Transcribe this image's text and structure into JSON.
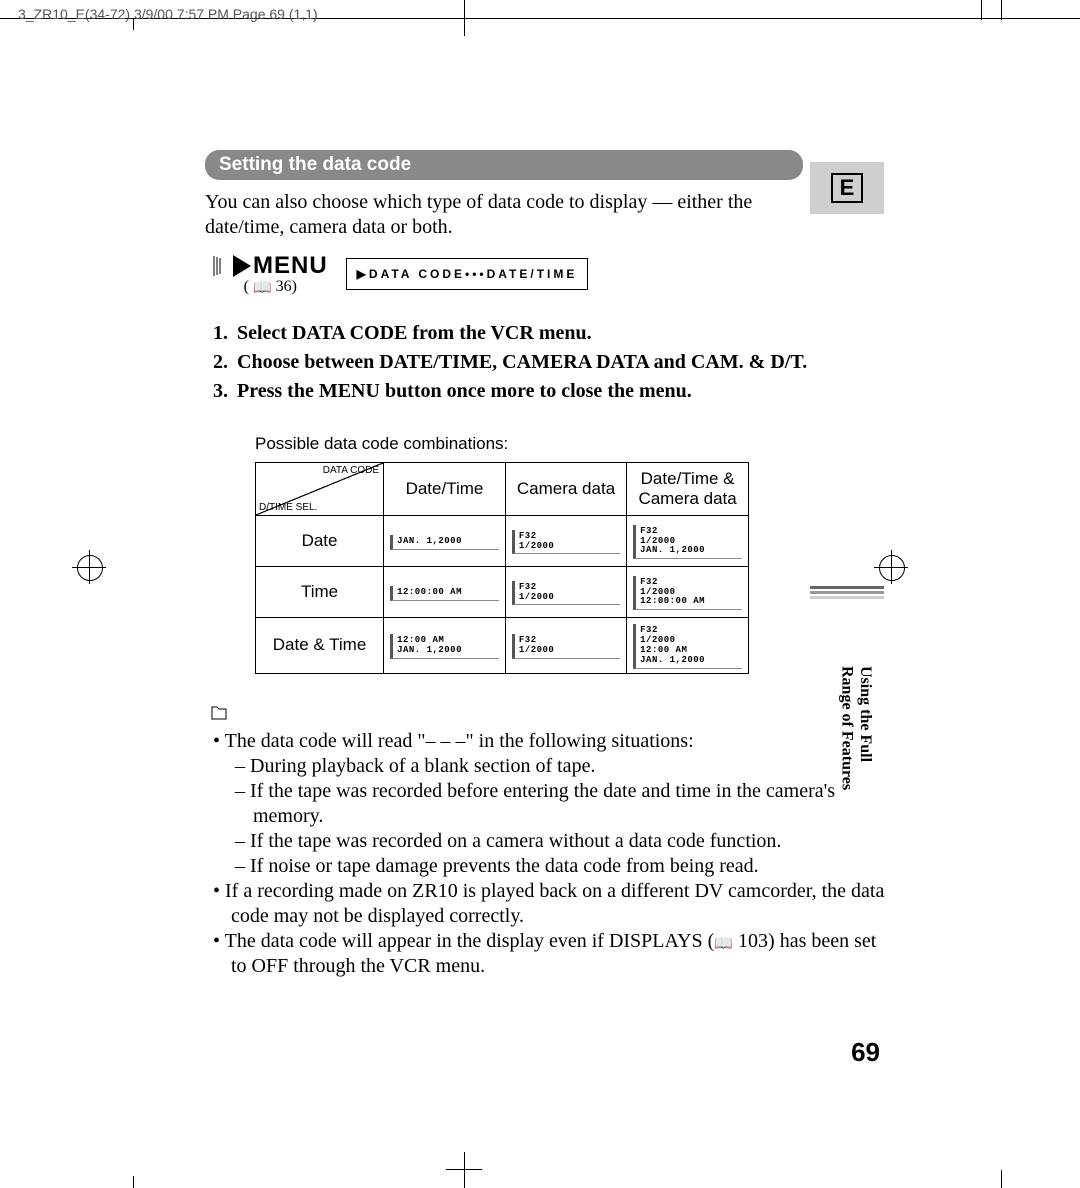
{
  "printmark": "3_ZR10_E(34-72)  3/9/00 7:57 PM  Page 69 (1,1)",
  "section_title": "Setting the data code",
  "intro": "You can also choose which type of data code to display — either the date/time, camera data or both.",
  "menu": {
    "word": "MENU",
    "ref": "36",
    "box": "DATA CODE•••DATE/TIME"
  },
  "steps": [
    "Select DATA CODE from the VCR menu.",
    "Choose between DATE/TIME, CAMERA DATA and CAM. & D/T.",
    "Press the MENU button once more to close the menu."
  ],
  "combo": {
    "label": "Possible data code combinations:",
    "corner_a": "DATA CODE",
    "corner_b": "D/TIME SEL.",
    "cols": [
      "Date/Time",
      "Camera data",
      "Date/Time & Camera data"
    ],
    "rows": [
      {
        "head": "Date",
        "cells": [
          [
            "JAN. 1,2000"
          ],
          [
            "F32",
            "1/2000"
          ],
          [
            "F32",
            "1/2000",
            "JAN. 1,2000"
          ]
        ]
      },
      {
        "head": "Time",
        "cells": [
          [
            "12:00:00 AM"
          ],
          [
            "F32",
            "1/2000"
          ],
          [
            "F32",
            "1/2000",
            "12:00:00 AM"
          ]
        ]
      },
      {
        "head": "Date & Time",
        "cells": [
          [
            "12:00 AM",
            "JAN. 1,2000"
          ],
          [
            "F32",
            "1/2000"
          ],
          [
            "F32",
            "1/2000",
            "12:00 AM",
            "JAN. 1,2000"
          ]
        ]
      }
    ]
  },
  "notes": {
    "b1": "The data code will read \"– – –\" in the following situations:",
    "b1sub": [
      "During playback of a blank section of tape.",
      "If the tape was recorded before entering the date and time in the camera's memory.",
      "If the tape was recorded on a camera without a data code function.",
      "If noise or tape damage prevents the data code from being read."
    ],
    "b2": "If a recording made on ZR10 is played back on a different DV camcorder, the data code may not be displayed correctly.",
    "b3a": "The data code will appear in the display even if DISPLAYS (",
    "b3ref": "103",
    "b3b": ") has been set to OFF through the VCR menu."
  },
  "side": {
    "line1": "Using the Full",
    "line2": "Range of Features"
  },
  "e_letter": "E",
  "page_number": "69"
}
